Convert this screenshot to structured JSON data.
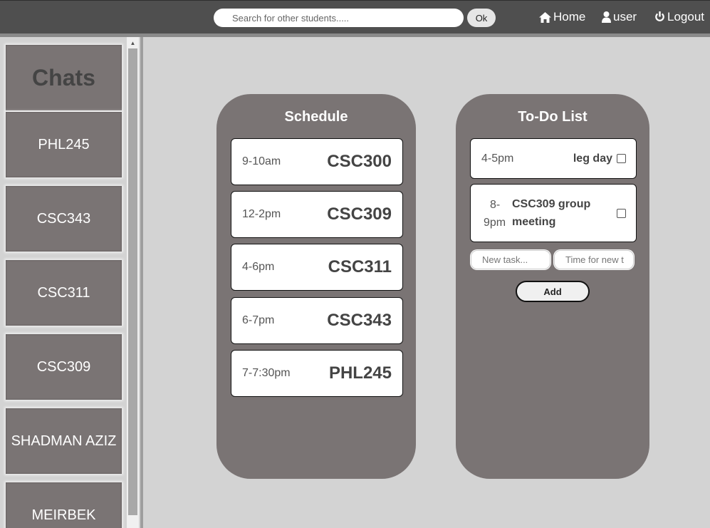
{
  "header": {
    "search_placeholder": "Search for other students.....",
    "ok_label": "Ok",
    "nav": {
      "home": "Home",
      "user": "user",
      "logout": "Logout"
    }
  },
  "sidebar": {
    "title": "Chats",
    "chats": [
      "PHL245",
      "CSC343",
      "CSC311",
      "CSC309",
      "SHADMAN AZIZ",
      "MEIRBEK"
    ]
  },
  "schedule": {
    "title": "Schedule",
    "items": [
      {
        "time": "9-10am",
        "course": "CSC300"
      },
      {
        "time": "12-2pm",
        "course": "CSC309"
      },
      {
        "time": "4-6pm",
        "course": "CSC311"
      },
      {
        "time": "6-7pm",
        "course": "CSC343"
      },
      {
        "time": "7-7:30pm",
        "course": "PHL245"
      }
    ]
  },
  "todo": {
    "title": "To-Do List",
    "items": [
      {
        "time": "4-5pm",
        "task": "leg day",
        "checked": false
      },
      {
        "time_line1": "8-",
        "time_line2": "9pm",
        "task_line1": "CSC309 group",
        "task_line2": "meeting",
        "checked": false
      }
    ],
    "new_task_placeholder": "New task...",
    "time_placeholder": "Time for new t",
    "add_label": "Add"
  },
  "colors": {
    "topbar": "#4f4f4f",
    "panel": "#7a7474",
    "background": "#d3d3d3"
  }
}
